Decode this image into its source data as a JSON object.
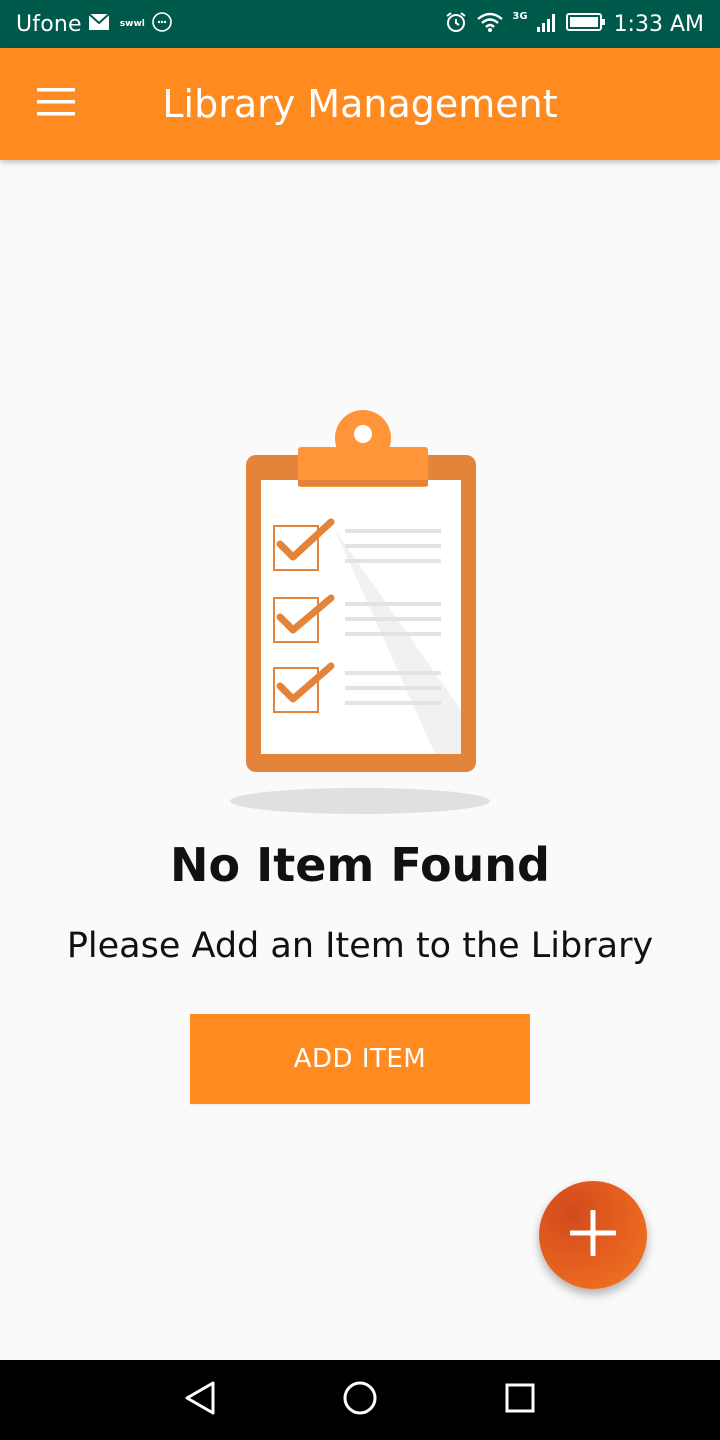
{
  "status_bar": {
    "carrier": "Ufone",
    "app_label": "swwl",
    "network_label": "3G",
    "time": "1:33 AM"
  },
  "app_bar": {
    "title": "Library Management"
  },
  "empty_state": {
    "title": "No Item Found",
    "subtitle": "Please Add an Item to the Library",
    "button_label": "ADD ITEM"
  },
  "colors": {
    "status_bar": "#005a4c",
    "primary": "#ff8a20",
    "accent": "#e8641f",
    "background": "#fafafa"
  },
  "icons": {
    "menu": "hamburger-menu-icon",
    "fab": "plus-icon",
    "nav_back": "triangle-back-icon",
    "nav_home": "circle-home-icon",
    "nav_recents": "square-recents-icon"
  }
}
